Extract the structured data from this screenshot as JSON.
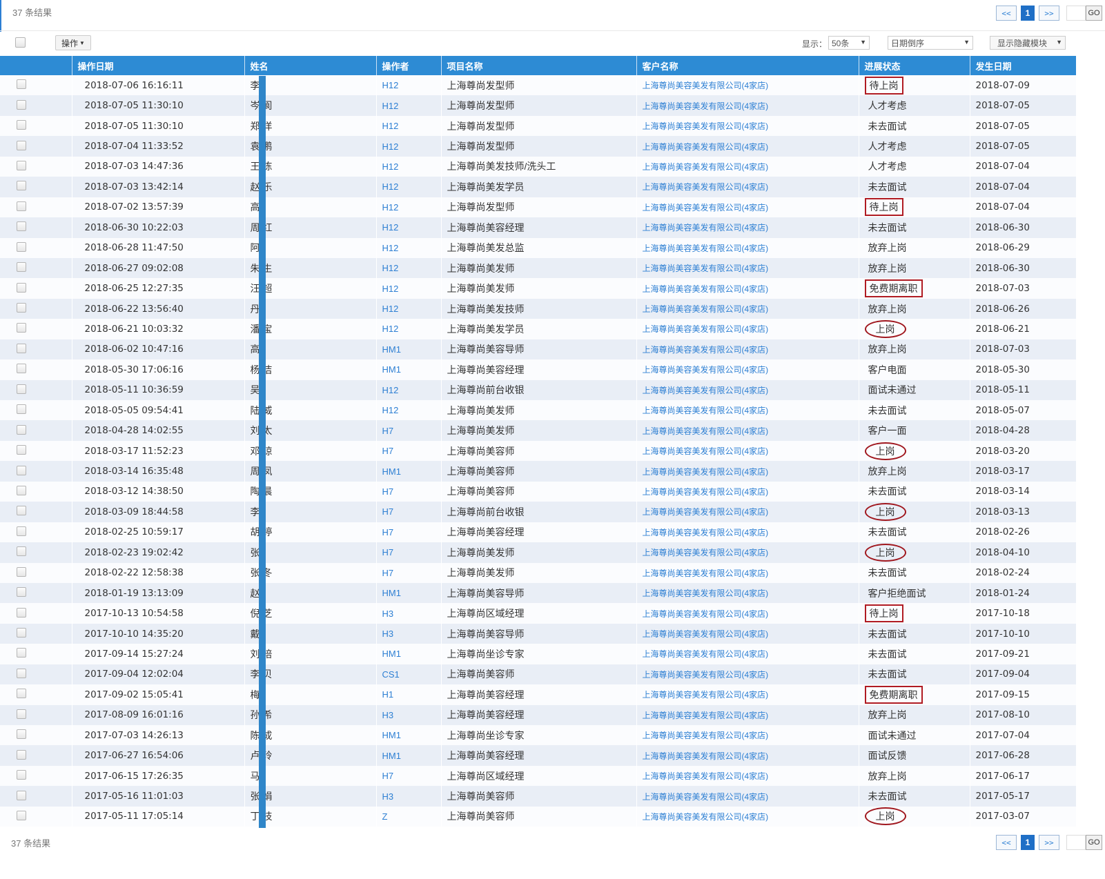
{
  "result_count": "37 条结果",
  "pager": {
    "prev": "<<",
    "current": "1",
    "next": ">>",
    "go": "GO"
  },
  "toolbar": {
    "ops_label": "操作",
    "show_label": "显示：",
    "page_size": "50条",
    "sort": "日期倒序",
    "modules": "显示隐藏模块"
  },
  "columns": [
    "操作日期",
    "姓名",
    "操作者",
    "项目名称",
    "客户名称",
    "进展状态",
    "发生日期"
  ],
  "rows": [
    {
      "date": "2018-07-06 16:16:11",
      "name": "李",
      "op": "H12",
      "project": "上海尊尚发型师",
      "customer": "上海尊尚美容美发有限公司(4家店)",
      "status": "待上岗",
      "mark": "box",
      "happen": "2018-07-09"
    },
    {
      "date": "2018-07-05 11:30:10",
      "name": "岑 阆",
      "op": "H12",
      "project": "上海尊尚发型师",
      "customer": "上海尊尚美容美发有限公司(4家店)",
      "status": "人才考虑",
      "mark": "",
      "happen": "2018-07-05"
    },
    {
      "date": "2018-07-05 11:30:10",
      "name": "郑 洋",
      "op": "H12",
      "project": "上海尊尚发型师",
      "customer": "上海尊尚美容美发有限公司(4家店)",
      "status": "未去面试",
      "mark": "",
      "happen": "2018-07-05"
    },
    {
      "date": "2018-07-04 11:33:52",
      "name": "袁 鹏",
      "op": "H12",
      "project": "上海尊尚发型师",
      "customer": "上海尊尚美容美发有限公司(4家店)",
      "status": "人才考虑",
      "mark": "",
      "happen": "2018-07-05"
    },
    {
      "date": "2018-07-03 14:47:36",
      "name": "王 栋",
      "op": "H12",
      "project": "上海尊尚美发技师/洗头工",
      "customer": "上海尊尚美容美发有限公司(4家店)",
      "status": "人才考虑",
      "mark": "",
      "happen": "2018-07-04"
    },
    {
      "date": "2018-07-03 13:42:14",
      "name": "赵 乐",
      "op": "H12",
      "project": "上海尊尚美发学员",
      "customer": "上海尊尚美容美发有限公司(4家店)",
      "status": "未去面试",
      "mark": "",
      "happen": "2018-07-04"
    },
    {
      "date": "2018-07-02 13:57:39",
      "name": "高",
      "op": "H12",
      "project": "上海尊尚发型师",
      "customer": "上海尊尚美容美发有限公司(4家店)",
      "status": "待上岗",
      "mark": "box",
      "happen": "2018-07-04"
    },
    {
      "date": "2018-06-30 10:22:03",
      "name": "周 红",
      "op": "H12",
      "project": "上海尊尚美容经理",
      "customer": "上海尊尚美容美发有限公司(4家店)",
      "status": "未去面试",
      "mark": "",
      "happen": "2018-06-30"
    },
    {
      "date": "2018-06-28 11:47:50",
      "name": "阿",
      "op": "H12",
      "project": "上海尊尚美发总监",
      "customer": "上海尊尚美容美发有限公司(4家店)",
      "status": "放弃上岗",
      "mark": "",
      "happen": "2018-06-29"
    },
    {
      "date": "2018-06-27 09:02:08",
      "name": "朱 生",
      "op": "H12",
      "project": "上海尊尚美发师",
      "customer": "上海尊尚美容美发有限公司(4家店)",
      "status": "放弃上岗",
      "mark": "",
      "happen": "2018-06-30"
    },
    {
      "date": "2018-06-25 12:27:35",
      "name": "汪 超",
      "op": "H12",
      "project": "上海尊尚美发师",
      "customer": "上海尊尚美容美发有限公司(4家店)",
      "status": "免费期离职",
      "mark": "box",
      "happen": "2018-07-03"
    },
    {
      "date": "2018-06-22 13:56:40",
      "name": "丹",
      "op": "H12",
      "project": "上海尊尚美发技师",
      "customer": "上海尊尚美容美发有限公司(4家店)",
      "status": "放弃上岗",
      "mark": "",
      "happen": "2018-06-26"
    },
    {
      "date": "2018-06-21 10:03:32",
      "name": "潘 宝",
      "op": "H12",
      "project": "上海尊尚美发学员",
      "customer": "上海尊尚美容美发有限公司(4家店)",
      "status": "上岗",
      "mark": "oval",
      "happen": "2018-06-21"
    },
    {
      "date": "2018-06-02 10:47:16",
      "name": "高",
      "op": "HM1",
      "project": "上海尊尚美容导师",
      "customer": "上海尊尚美容美发有限公司(4家店)",
      "status": "放弃上岗",
      "mark": "",
      "happen": "2018-07-03"
    },
    {
      "date": "2018-05-30 17:06:16",
      "name": "杨 洁",
      "op": "HM1",
      "project": "上海尊尚美容经理",
      "customer": "上海尊尚美容美发有限公司(4家店)",
      "status": "客户电面",
      "mark": "",
      "happen": "2018-05-30"
    },
    {
      "date": "2018-05-11 10:36:59",
      "name": "吴",
      "op": "H12",
      "project": "上海尊尚前台收银",
      "customer": "上海尊尚美容美发有限公司(4家店)",
      "status": "面试未通过",
      "mark": "",
      "happen": "2018-05-11"
    },
    {
      "date": "2018-05-05 09:54:41",
      "name": "陆 威",
      "op": "H12",
      "project": "上海尊尚美发师",
      "customer": "上海尊尚美容美发有限公司(4家店)",
      "status": "未去面试",
      "mark": "",
      "happen": "2018-05-07"
    },
    {
      "date": "2018-04-28 14:02:55",
      "name": "刘 太",
      "op": "H7",
      "project": "上海尊尚美发师",
      "customer": "上海尊尚美容美发有限公司(4家店)",
      "status": "客户一面",
      "mark": "",
      "happen": "2018-04-28"
    },
    {
      "date": "2018-03-17 11:52:23",
      "name": "邓 琼",
      "op": "H7",
      "project": "上海尊尚美容师",
      "customer": "上海尊尚美容美发有限公司(4家店)",
      "status": "上岗",
      "mark": "oval",
      "happen": "2018-03-20"
    },
    {
      "date": "2018-03-14 16:35:48",
      "name": "周 凤",
      "op": "HM1",
      "project": "上海尊尚美容师",
      "customer": "上海尊尚美容美发有限公司(4家店)",
      "status": "放弃上岗",
      "mark": "",
      "happen": "2018-03-17"
    },
    {
      "date": "2018-03-12 14:38:50",
      "name": "陶 晨",
      "op": "H7",
      "project": "上海尊尚美容师",
      "customer": "上海尊尚美容美发有限公司(4家店)",
      "status": "未去面试",
      "mark": "",
      "happen": "2018-03-14"
    },
    {
      "date": "2018-03-09 18:44:58",
      "name": "李",
      "op": "H7",
      "project": "上海尊尚前台收银",
      "customer": "上海尊尚美容美发有限公司(4家店)",
      "status": "上岗",
      "mark": "oval",
      "happen": "2018-03-13"
    },
    {
      "date": "2018-02-25 10:59:17",
      "name": "胡 婷",
      "op": "H7",
      "project": "上海尊尚美容经理",
      "customer": "上海尊尚美容美发有限公司(4家店)",
      "status": "未去面试",
      "mark": "",
      "happen": "2018-02-26"
    },
    {
      "date": "2018-02-23 19:02:42",
      "name": "张",
      "op": "H7",
      "project": "上海尊尚美发师",
      "customer": "上海尊尚美容美发有限公司(4家店)",
      "status": "上岗",
      "mark": "oval",
      "happen": "2018-04-10"
    },
    {
      "date": "2018-02-22 12:58:38",
      "name": "张 冬",
      "op": "H7",
      "project": "上海尊尚美发师",
      "customer": "上海尊尚美容美发有限公司(4家店)",
      "status": "未去面试",
      "mark": "",
      "happen": "2018-02-24"
    },
    {
      "date": "2018-01-19 13:13:09",
      "name": "赵",
      "op": "HM1",
      "project": "上海尊尚美容导师",
      "customer": "上海尊尚美容美发有限公司(4家店)",
      "status": "客户拒绝面试",
      "mark": "",
      "happen": "2018-01-24"
    },
    {
      "date": "2017-10-13 10:54:58",
      "name": "倪 芝",
      "op": "H3",
      "project": "上海尊尚区域经理",
      "customer": "上海尊尚美容美发有限公司(4家店)",
      "status": "待上岗",
      "mark": "box",
      "happen": "2017-10-18"
    },
    {
      "date": "2017-10-10 14:35:20",
      "name": "戴",
      "op": "H3",
      "project": "上海尊尚美容导师",
      "customer": "上海尊尚美容美发有限公司(4家店)",
      "status": "未去面试",
      "mark": "",
      "happen": "2017-10-10"
    },
    {
      "date": "2017-09-14 15:27:24",
      "name": "刘 培",
      "op": "HM1",
      "project": "上海尊尚坐诊专家",
      "customer": "上海尊尚美容美发有限公司(4家店)",
      "status": "未去面试",
      "mark": "",
      "happen": "2017-09-21"
    },
    {
      "date": "2017-09-04 12:02:04",
      "name": "李 贝",
      "op": "CS1",
      "project": "上海尊尚美容师",
      "customer": "上海尊尚美容美发有限公司(4家店)",
      "status": "未去面试",
      "mark": "",
      "happen": "2017-09-04"
    },
    {
      "date": "2017-09-02 15:05:41",
      "name": "梅",
      "op": "H1",
      "project": "上海尊尚美容经理",
      "customer": "上海尊尚美容美发有限公司(4家店)",
      "status": "免费期离职",
      "mark": "box",
      "happen": "2017-09-15"
    },
    {
      "date": "2017-08-09 16:01:16",
      "name": "孙 希",
      "op": "H3",
      "project": "上海尊尚美容经理",
      "customer": "上海尊尚美容美发有限公司(4家店)",
      "status": "放弃上岗",
      "mark": "",
      "happen": "2017-08-10"
    },
    {
      "date": "2017-07-03 14:26:13",
      "name": "陈 成",
      "op": "HM1",
      "project": "上海尊尚坐诊专家",
      "customer": "上海尊尚美容美发有限公司(4家店)",
      "status": "面试未通过",
      "mark": "",
      "happen": "2017-07-04"
    },
    {
      "date": "2017-06-27 16:54:06",
      "name": "卢 玲",
      "op": "HM1",
      "project": "上海尊尚美容经理",
      "customer": "上海尊尚美容美发有限公司(4家店)",
      "status": "面试反馈",
      "mark": "",
      "happen": "2017-06-28"
    },
    {
      "date": "2017-06-15 17:26:35",
      "name": "马",
      "op": "H7",
      "project": "上海尊尚区域经理",
      "customer": "上海尊尚美容美发有限公司(4家店)",
      "status": "放弃上岗",
      "mark": "",
      "happen": "2017-06-17"
    },
    {
      "date": "2017-05-16 11:01:03",
      "name": "张 娟",
      "op": "H3",
      "project": "上海尊尚美容师",
      "customer": "上海尊尚美容美发有限公司(4家店)",
      "status": "未去面试",
      "mark": "",
      "happen": "2017-05-17"
    },
    {
      "date": "2017-05-11 17:05:14",
      "name": "丁 枝",
      "op": "Z",
      "project": "上海尊尚美容师",
      "customer": "上海尊尚美容美发有限公司(4家店)",
      "status": "上岗",
      "mark": "oval",
      "happen": "2017-03-07"
    }
  ]
}
